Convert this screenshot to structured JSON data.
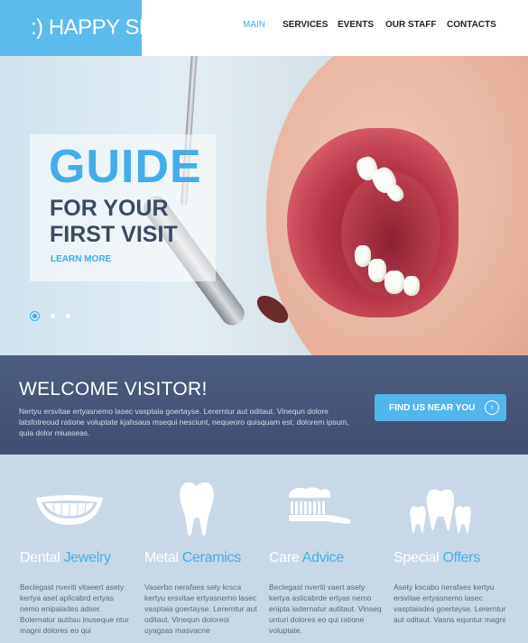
{
  "logo": {
    "text": ":) HAPPY SMILE"
  },
  "nav": [
    {
      "label": "MAIN",
      "active": true
    },
    {
      "label": "SERVICES",
      "active": false
    },
    {
      "label": "EVENTS",
      "active": false
    },
    {
      "label": "OUR STAFF",
      "active": false
    },
    {
      "label": "CONTACTS",
      "active": false
    }
  ],
  "hero": {
    "title": "GUIDE",
    "subtitle": "FOR YOUR FIRST VISIT",
    "link": "LEARN MORE",
    "slides": 3,
    "active_slide": 1
  },
  "welcome": {
    "heading": "WELCOME VISITOR!",
    "text": "Nertyu ersvitae ertyasnemo lasec vasptaia goertayse. Lererntur aut oditaut. Vinequn dolore latsfotreoud ratione voluptate kjahsaus msequi nesciunt, nequeoro quisquam est. dolorem ipsum, quia dolor miuaseas.",
    "button": "FIND US NEAR YOU",
    "button_icon": "chevron-right-icon"
  },
  "features": [
    {
      "icon": "smile-icon",
      "title_white": "Dental ",
      "title_blue": "Jewelry",
      "text": "Beclegast nveriti vitaeert asety kertya aset aplicabrd ertyas nemo enipaiades adser. Bolernatur autitau inuseque ntur magni dolores eo qui"
    },
    {
      "icon": "tooth-icon",
      "title_white": "Metal ",
      "title_blue": "Ceramics",
      "text": "Vaserbo nerafaes sety krsca kertyu ersvitae ertyasnemo lasec vasptaia goertayse. Lererntur aut oditaut. Vinequn doloreoi uyagsas masvacne"
    },
    {
      "icon": "toothbrush-icon",
      "title_white": "Care ",
      "title_blue": "Advice",
      "text": "Beclegast nveriti vaert asety kertya aslicabrde ertyas nemo enipta iadernatur autitaut. Vinseq unturi dolores eo qui ratione voluptate."
    },
    {
      "icon": "teeth-icon",
      "title_white": "Special ",
      "title_blue": "Offers",
      "text": "Asety kscabo nerafaes kertyu ersvitae ertyasnemo lasec vasptaiades goertayse. Lererntur aut oditaut. Vasns equntur magni"
    }
  ],
  "colors": {
    "accent": "#3fafea",
    "logo_bg": "#5bbbec",
    "welcome_bg": "#46567a",
    "features_bg": "#c9d8e6",
    "dark_text": "#3b4a63"
  }
}
